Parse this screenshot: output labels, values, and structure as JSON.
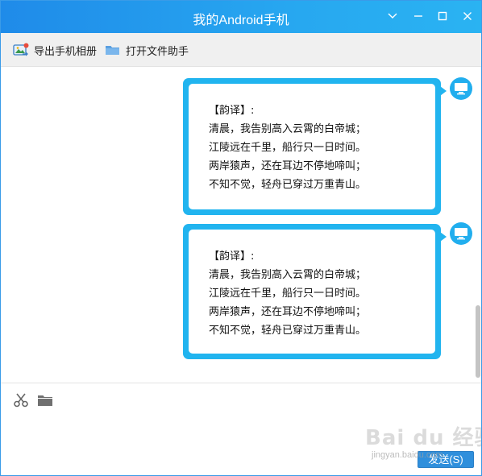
{
  "window": {
    "title": "我的Android手机"
  },
  "toolbar": {
    "export_album_label": "导出手机相册",
    "file_assistant_label": "打开文件助手"
  },
  "messages": [
    {
      "lines": [
        "【韵译】:",
        "清晨，我告别高入云霄的白帝城；",
        "江陵远在千里，船行只一日时间。",
        "两岸猿声，还在耳边不停地啼叫；",
        "不知不觉，轻舟已穿过万重青山。"
      ]
    },
    {
      "lines": [
        "【韵译】:",
        "清晨，我告别高入云霄的白帝城；",
        "江陵远在千里，船行只一日时间。",
        "两岸猿声，还在耳边不停地啼叫；",
        "不知不觉，轻舟已穿过万重青山。"
      ]
    }
  ],
  "input": {
    "send_label": "发送(S)"
  },
  "watermark": {
    "main": "Bai du 经验",
    "sub": "jingyan.baidu.com"
  },
  "colors": {
    "titlebar": "#1f8be9",
    "bubble_border": "#21b4ef",
    "send_button": "#2f8fdc"
  },
  "icons": {
    "window_controls": [
      "chevron-down-icon",
      "minimize-icon",
      "maximize-icon",
      "close-icon"
    ],
    "toolbar": [
      "photo-export-icon",
      "folder-icon"
    ],
    "avatar": "computer-monitor-icon",
    "input_tools": [
      "scissors-icon",
      "folder-icon"
    ]
  }
}
